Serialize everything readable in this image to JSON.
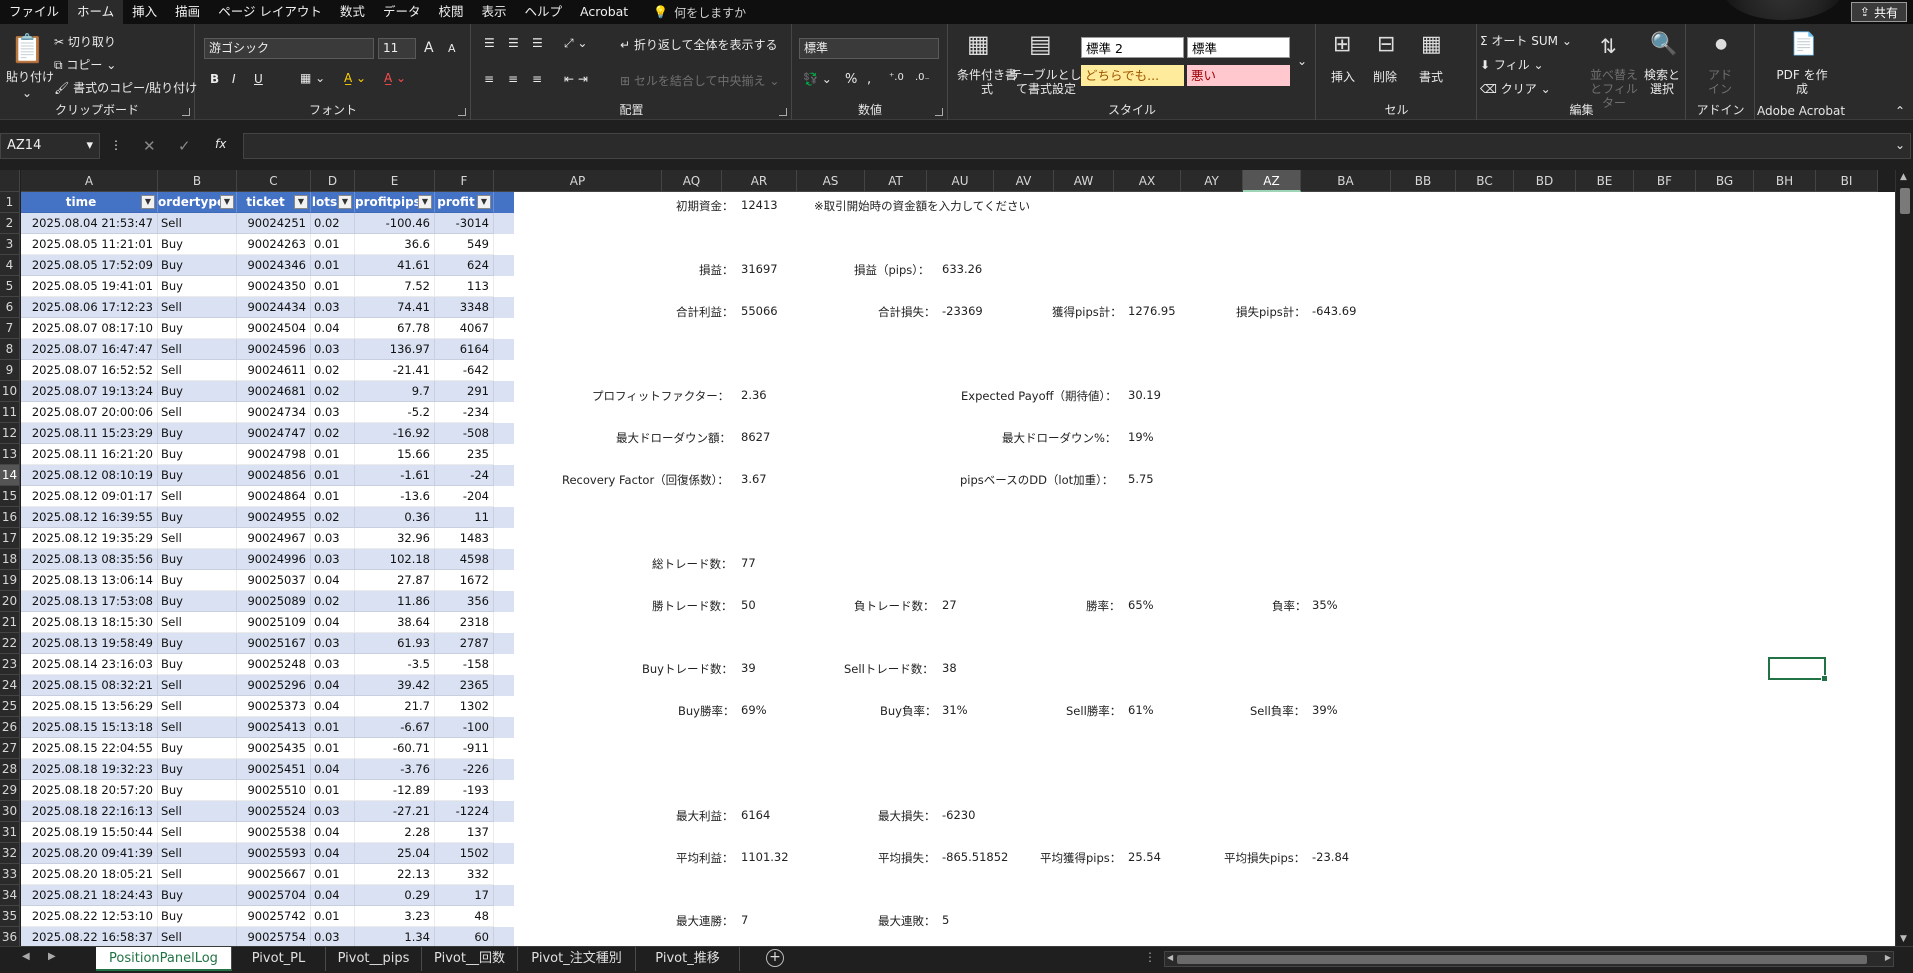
{
  "menu": {
    "tabs": [
      "ファイル",
      "ホーム",
      "挿入",
      "描画",
      "ページ レイアウト",
      "数式",
      "データ",
      "校閲",
      "表示",
      "ヘルプ",
      "Acrobat"
    ],
    "active": "ホーム",
    "tellme": "何をしますか",
    "share": "共有"
  },
  "ribbon": {
    "clipboard": {
      "label": "クリップボード",
      "paste": "貼り付け",
      "cut": "切り取り",
      "copy": "コピー",
      "format_painter": "書式のコピー/貼り付け"
    },
    "font": {
      "label": "フォント",
      "name": "游ゴシック",
      "size": "11",
      "bold": "B",
      "italic": "I",
      "underline": "U",
      "grow": "A",
      "shrink": "A"
    },
    "alignment": {
      "label": "配置",
      "wrap": "折り返して全体を表示する",
      "merge": "セルを結合して中央揃え"
    },
    "number": {
      "label": "数値",
      "format": "標準",
      "percent": "%",
      "comma": ","
    },
    "styles": {
      "label": "スタイル",
      "conditional": "条件付き書式",
      "table": "テーブルとして書式設定",
      "style1": "標準 2",
      "style2": "標準",
      "style3": "どちらでも...",
      "style4": "悪い"
    },
    "cells": {
      "label": "セル",
      "insert": "挿入",
      "delete": "削除",
      "format": "書式"
    },
    "editing": {
      "label": "編集",
      "autosum": "オート SUM",
      "fill": "フィル",
      "clear": "クリア",
      "sort": "並べ替えとフィルター",
      "find": "検索と選択"
    },
    "addins": {
      "label": "アドイン",
      "addin": "アドイン"
    },
    "acrobat": {
      "label": "Adobe Acrobat",
      "pdf": "PDF を作成"
    }
  },
  "formula_bar": {
    "name_box": "AZ14",
    "fx": "fx"
  },
  "columns_left": [
    "A",
    "B",
    "C",
    "D",
    "E",
    "F"
  ],
  "columns_right": [
    "AP",
    "AQ",
    "AR",
    "AS",
    "AT",
    "AU",
    "AV",
    "AW",
    "AX",
    "AY",
    "AZ",
    "BA",
    "BB",
    "BC",
    "BD",
    "BE",
    "BF",
    "BG",
    "BH",
    "BI"
  ],
  "selected_column": "AZ",
  "selected_row": "14",
  "table": {
    "headers": [
      "time",
      "ordertype",
      "ticket",
      "lots",
      "profitpips",
      "profit"
    ],
    "rows": [
      [
        "2025.08.04 21:53:47",
        "Sell",
        "90024251",
        "0.02",
        "-100.46",
        "-3014"
      ],
      [
        "2025.08.05 11:21:01",
        "Buy",
        "90024263",
        "0.01",
        "36.6",
        "549"
      ],
      [
        "2025.08.05 17:52:09",
        "Buy",
        "90024346",
        "0.01",
        "41.61",
        "624"
      ],
      [
        "2025.08.05 19:41:01",
        "Buy",
        "90024350",
        "0.01",
        "7.52",
        "113"
      ],
      [
        "2025.08.06 17:12:23",
        "Sell",
        "90024434",
        "0.03",
        "74.41",
        "3348"
      ],
      [
        "2025.08.07 08:17:10",
        "Buy",
        "90024504",
        "0.04",
        "67.78",
        "4067"
      ],
      [
        "2025.08.07 16:47:47",
        "Sell",
        "90024596",
        "0.03",
        "136.97",
        "6164"
      ],
      [
        "2025.08.07 16:52:52",
        "Sell",
        "90024611",
        "0.02",
        "-21.41",
        "-642"
      ],
      [
        "2025.08.07 19:13:24",
        "Buy",
        "90024681",
        "0.02",
        "9.7",
        "291"
      ],
      [
        "2025.08.07 20:00:06",
        "Sell",
        "90024734",
        "0.03",
        "-5.2",
        "-234"
      ],
      [
        "2025.08.11 15:23:29",
        "Buy",
        "90024747",
        "0.02",
        "-16.92",
        "-508"
      ],
      [
        "2025.08.11 16:21:20",
        "Buy",
        "90024798",
        "0.01",
        "15.66",
        "235"
      ],
      [
        "2025.08.12 08:10:19",
        "Buy",
        "90024856",
        "0.01",
        "-1.61",
        "-24"
      ],
      [
        "2025.08.12 09:01:17",
        "Sell",
        "90024864",
        "0.01",
        "-13.6",
        "-204"
      ],
      [
        "2025.08.12 16:39:55",
        "Buy",
        "90024955",
        "0.02",
        "0.36",
        "11"
      ],
      [
        "2025.08.12 19:35:29",
        "Sell",
        "90024967",
        "0.03",
        "32.96",
        "1483"
      ],
      [
        "2025.08.13 08:35:56",
        "Buy",
        "90024996",
        "0.03",
        "102.18",
        "4598"
      ],
      [
        "2025.08.13 13:06:14",
        "Buy",
        "90025037",
        "0.04",
        "27.87",
        "1672"
      ],
      [
        "2025.08.13 17:53:08",
        "Buy",
        "90025089",
        "0.02",
        "11.86",
        "356"
      ],
      [
        "2025.08.13 18:15:30",
        "Sell",
        "90025109",
        "0.04",
        "38.64",
        "2318"
      ],
      [
        "2025.08.13 19:58:49",
        "Buy",
        "90025167",
        "0.03",
        "61.93",
        "2787"
      ],
      [
        "2025.08.14 23:16:03",
        "Buy",
        "90025248",
        "0.03",
        "-3.5",
        "-158"
      ],
      [
        "2025.08.15 08:32:21",
        "Sell",
        "90025296",
        "0.04",
        "39.42",
        "2365"
      ],
      [
        "2025.08.15 13:56:29",
        "Sell",
        "90025373",
        "0.04",
        "21.7",
        "1302"
      ],
      [
        "2025.08.15 15:13:18",
        "Sell",
        "90025413",
        "0.01",
        "-6.67",
        "-100"
      ],
      [
        "2025.08.15 22:04:55",
        "Buy",
        "90025435",
        "0.01",
        "-60.71",
        "-911"
      ],
      [
        "2025.08.18 19:32:23",
        "Buy",
        "90025451",
        "0.04",
        "-3.76",
        "-226"
      ],
      [
        "2025.08.18 20:57:20",
        "Buy",
        "90025510",
        "0.01",
        "-12.89",
        "-193"
      ],
      [
        "2025.08.18 22:16:13",
        "Sell",
        "90025524",
        "0.03",
        "-27.21",
        "-1224"
      ],
      [
        "2025.08.19 15:50:44",
        "Sell",
        "90025538",
        "0.04",
        "2.28",
        "137"
      ],
      [
        "2025.08.20 09:41:39",
        "Sell",
        "90025593",
        "0.04",
        "25.04",
        "1502"
      ],
      [
        "2025.08.20 18:05:21",
        "Sell",
        "90025667",
        "0.01",
        "22.13",
        "332"
      ],
      [
        "2025.08.21 18:24:43",
        "Buy",
        "90025704",
        "0.04",
        "0.29",
        "17"
      ],
      [
        "2025.08.22 12:53:10",
        "Buy",
        "90025742",
        "0.01",
        "3.23",
        "48"
      ],
      [
        "2025.08.22 16:58:37",
        "Sell",
        "90025754",
        "0.03",
        "1.34",
        "60"
      ]
    ]
  },
  "stats": {
    "initial_label": "初期資金：",
    "initial_value": "12413",
    "initial_note": "※取引開始時の資金額を入力してください",
    "pl_label": "損益：",
    "pl_value": "31697",
    "pl_pips_label": "損益（pips）：",
    "pl_pips_value": "633.26",
    "total_profit_label": "合計利益：",
    "total_profit_value": "55066",
    "total_loss_label": "合計損失：",
    "total_loss_value": "-23369",
    "gain_pips_label": "獲得pips計：",
    "gain_pips_value": "1276.95",
    "loss_pips_label": "損失pips計：",
    "loss_pips_value": "-643.69",
    "pf_label": "プロフィットファクター：",
    "pf_value": "2.36",
    "ep_label": "Expected Payoff（期待値）：",
    "ep_value": "30.19",
    "maxdd_label": "最大ドローダウン額：",
    "maxdd_value": "8627",
    "maxdd_pct_label": "最大ドローダウン%：",
    "maxdd_pct_value": "19%",
    "rf_label": "Recovery Factor（回復係数）：",
    "rf_value": "3.67",
    "pipsdd_label": "pipsベースのDD（lot加重）：",
    "pipsdd_value": "5.75",
    "trades_label": "総トレード数：",
    "trades_value": "77",
    "wins_label": "勝トレード数：",
    "wins_value": "50",
    "losses_label": "負トレード数：",
    "losses_value": "27",
    "winrate_label": "勝率：",
    "winrate_value": "65%",
    "lossrate_label": "負率：",
    "lossrate_value": "35%",
    "buy_trades_label": "Buyトレード数：",
    "buy_trades_value": "39",
    "sell_trades_label": "Sellトレード数：",
    "sell_trades_value": "38",
    "buy_win_label": "Buy勝率：",
    "buy_win_value": "69%",
    "buy_loss_label": "Buy負率：",
    "buy_loss_value": "31%",
    "sell_win_label": "Sell勝率：",
    "sell_win_value": "61%",
    "sell_loss_label": "Sell負率：",
    "sell_loss_value": "39%",
    "max_profit_label": "最大利益：",
    "max_profit_value": "6164",
    "max_loss_label": "最大損失：",
    "max_loss_value": "-6230",
    "avg_profit_label": "平均利益：",
    "avg_profit_value": "1101.32",
    "avg_loss_label": "平均損失：",
    "avg_loss_value": "-865.51852",
    "avg_gain_pips_label": "平均獲得pips：",
    "avg_gain_pips_value": "25.54",
    "avg_loss_pips_label": "平均損失pips：",
    "avg_loss_pips_value": "-23.84",
    "max_win_streak_label": "最大連勝：",
    "max_win_streak_value": "7",
    "max_loss_streak_label": "最大連敗：",
    "max_loss_streak_value": "5"
  },
  "sheet_tabs": [
    "PositionPanelLog",
    "Pivot_PL",
    "Pivot__pips",
    "Pivot__回数",
    "Pivot_注文種別",
    "Pivot_推移"
  ],
  "active_sheet": "PositionPanelLog",
  "colors": {
    "header_blue": "#4472c4",
    "band": "#d9e1f2",
    "accent_green": "#217346"
  }
}
